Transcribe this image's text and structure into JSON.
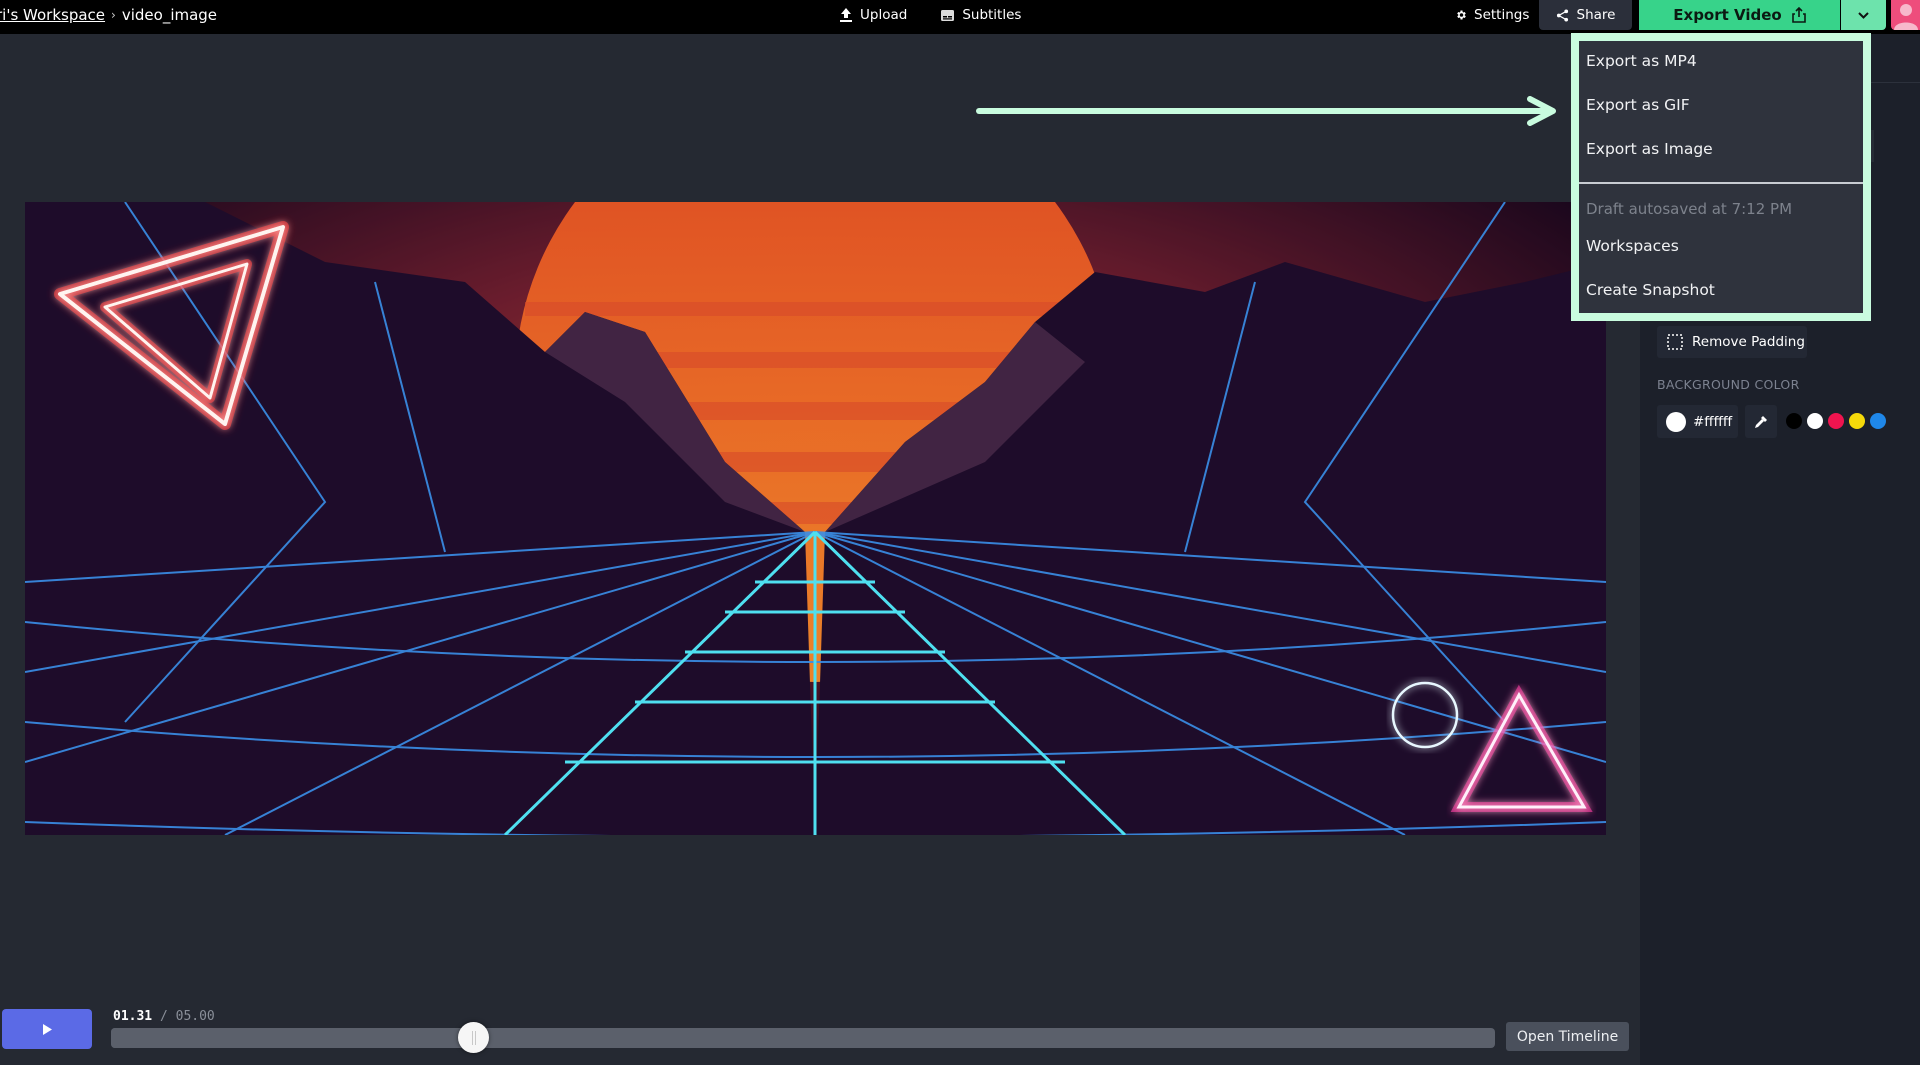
{
  "header": {
    "workspace_link": "ri's Workspace",
    "breadcrumb_separator": "›",
    "project_name": "video_image",
    "upload_label": "Upload",
    "subtitles_label": "Subtitles",
    "settings_label": "Settings",
    "share_label": "Share",
    "export_label": "Export Video"
  },
  "export_menu": {
    "items": [
      {
        "label": "Export as MP4"
      },
      {
        "label": "Export as GIF"
      },
      {
        "label": "Export as Image"
      }
    ],
    "autosave_note": "Draft autosaved at 7:12 PM",
    "secondary_items": [
      {
        "label": "Workspaces"
      },
      {
        "label": "Create Snapshot"
      }
    ]
  },
  "right_panel": {
    "remove_padding_label": "Remove Padding",
    "background_color_heading": "BACKGROUND COLOR",
    "background_color_value": "#ffffff",
    "swatches": [
      "#000000",
      "#ffffff",
      "#f0144f",
      "#f5d90a",
      "#1f87e8"
    ]
  },
  "playback": {
    "current_time": "01.31",
    "separator": "/",
    "total_time": "05.00",
    "progress": 0.262,
    "open_timeline_label": "Open Timeline"
  },
  "colors": {
    "accent_green": "#37d38a",
    "highlight_mint": "#c9fcdf",
    "play_blue": "#5b6ae6",
    "avatar_pink": "#ee4d7c"
  },
  "video": {
    "description": "Synthwave neon landscape with sun, wireframe mountains, and neon triangles"
  }
}
